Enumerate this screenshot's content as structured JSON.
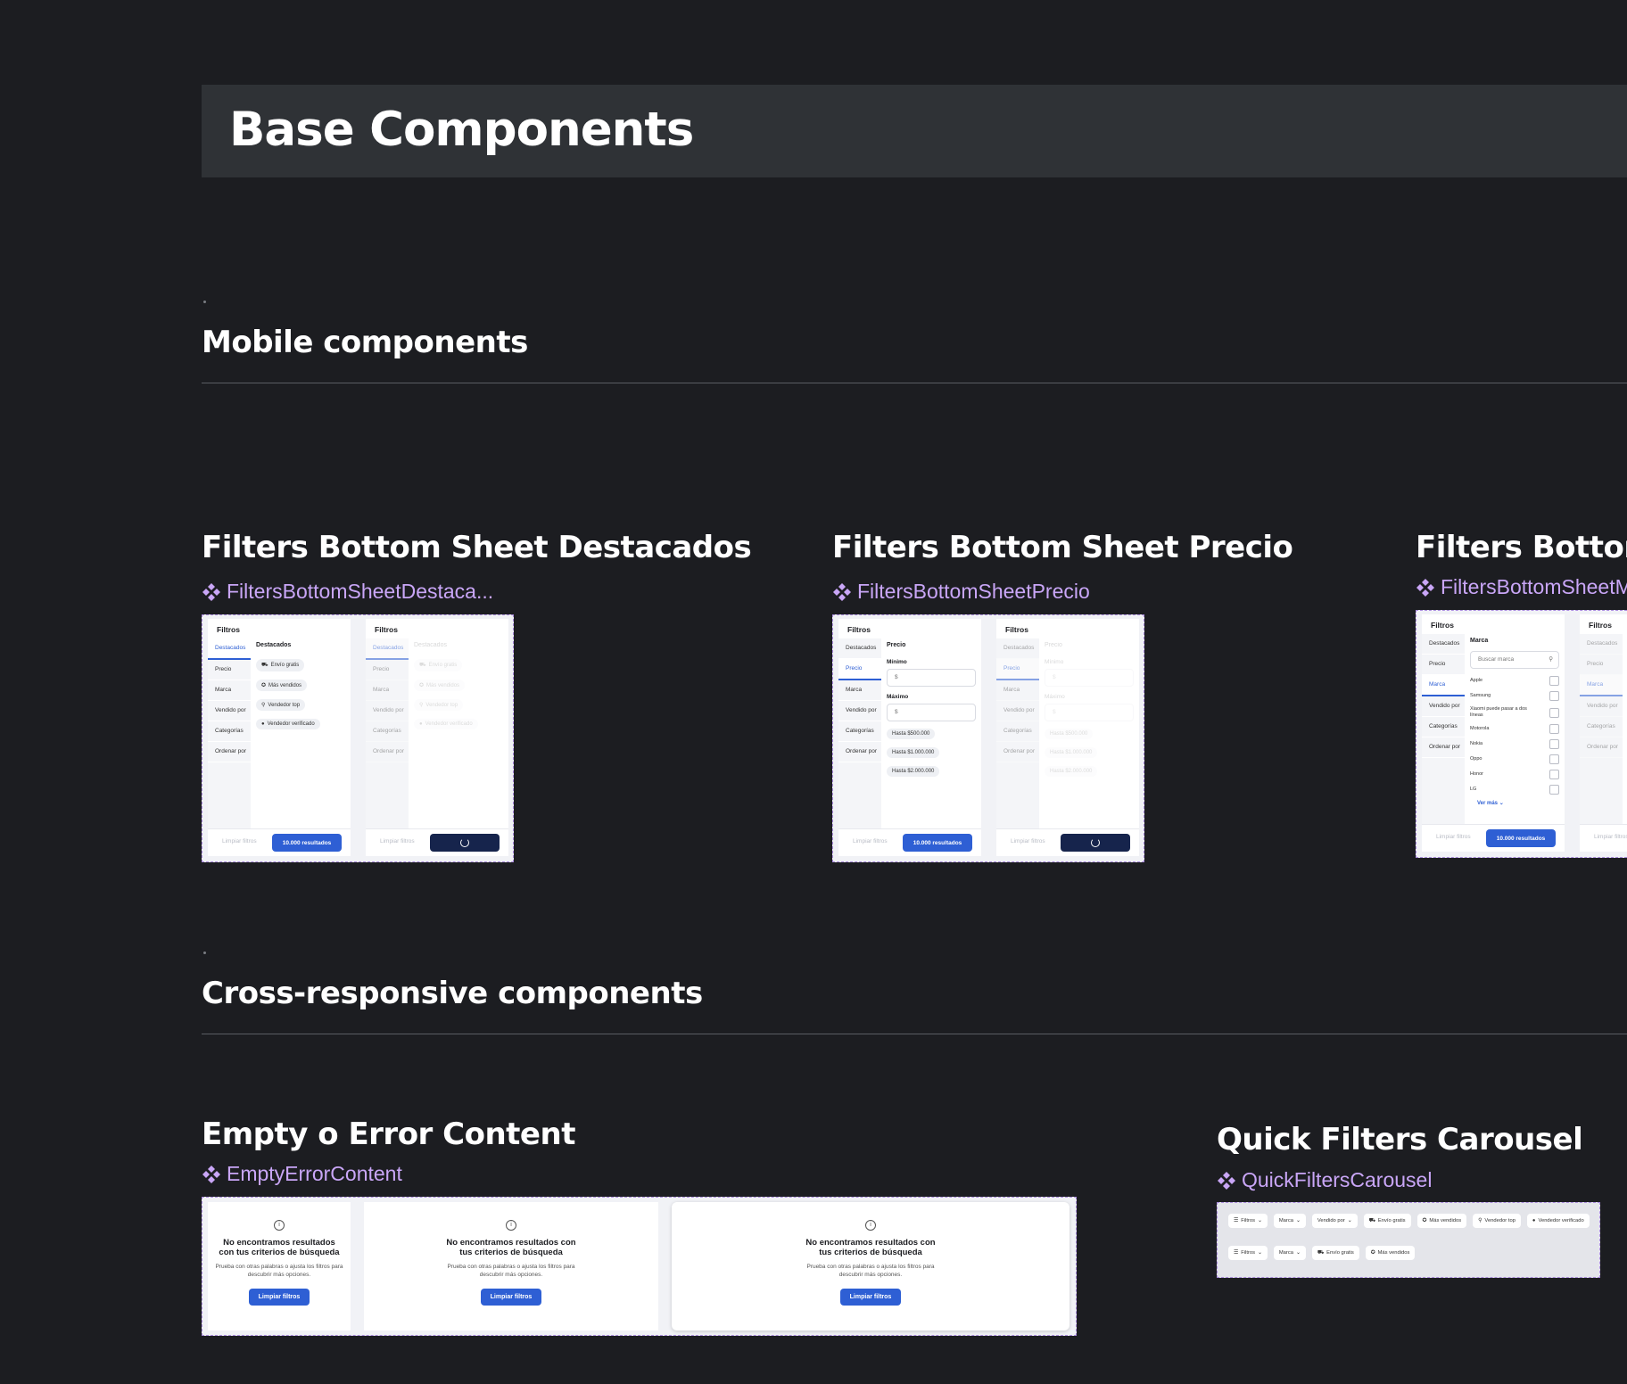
{
  "banner": {
    "title": "Base Components"
  },
  "sections": {
    "mobile": "Mobile components",
    "cross": "Cross-responsive components"
  },
  "components": {
    "destacados": {
      "title": "Filters Bottom Sheet Destacados",
      "link": "FiltersBottomSheetDestaca..."
    },
    "precio": {
      "title": "Filters Bottom Sheet Precio",
      "link": "FiltersBottomSheetPrecio"
    },
    "marca": {
      "title": "Filters Bottom S",
      "link": "FiltersBottomSheetM"
    },
    "empty": {
      "title": "Empty o Error Content",
      "link": "EmptyErrorContent"
    },
    "quick": {
      "title": "Quick Filters Carousel",
      "link": "QuickFiltersCarousel"
    }
  },
  "sheet": {
    "header": "Filtros",
    "sidebar": [
      "Destacados",
      "Precio",
      "Marca",
      "Vendido por",
      "Categorías",
      "Ordenar por"
    ],
    "clear": "Limpiar filtros",
    "results": "10.000 resultados"
  },
  "destacados_content": {
    "title": "Destacados",
    "chips": [
      {
        "icon": "truck-icon",
        "glyph": "⛟",
        "label": "Envío gratis"
      },
      {
        "icon": "star-icon",
        "glyph": "✪",
        "label": "Más vendidos"
      },
      {
        "icon": "medal-icon",
        "glyph": "⚲",
        "label": "Vendedor top"
      },
      {
        "icon": "verified-icon",
        "glyph": "●",
        "label": "Vendedor verificado"
      }
    ]
  },
  "precio_content": {
    "title": "Precio",
    "min_label": "Mínimo",
    "max_label": "Máximo",
    "currency": "$",
    "chips": [
      "Hasta $500.000",
      "Hasta $1.000.000",
      "Hasta $2.000.000"
    ]
  },
  "marca_content": {
    "title": "Marca",
    "search_placeholder": "Buscar marca",
    "brands": [
      "Apple",
      "Samsung",
      "Xiaomi puede pasar a dos líneas",
      "Motorola",
      "Nokia",
      "Oppo",
      "Honor",
      "LG"
    ],
    "see_more": "Ver más"
  },
  "empty_content": {
    "title": "No encontramos resultados con tus criterios de búsqueda",
    "subtitle": "Prueba con otras palabras o ajusta los filtros para descubrir más opciones.",
    "button": "Limpiar filtros"
  },
  "quick_filters": {
    "row1": [
      {
        "icon": "sliders-icon",
        "glyph": "☰",
        "label": "Filtros",
        "chevron": true
      },
      {
        "icon": "",
        "glyph": "",
        "label": "Marca",
        "chevron": true
      },
      {
        "icon": "",
        "glyph": "",
        "label": "Vendido por",
        "chevron": true
      },
      {
        "icon": "truck-icon",
        "glyph": "⛟",
        "label": "Envío gratis",
        "chevron": false
      },
      {
        "icon": "star-icon",
        "glyph": "✪",
        "label": "Más vendidos",
        "chevron": false
      },
      {
        "icon": "medal-icon",
        "glyph": "⚲",
        "label": "Vendedor top",
        "chevron": false
      },
      {
        "icon": "verified-icon",
        "glyph": "●",
        "label": "Vendedor verificado",
        "chevron": false
      }
    ],
    "row2": [
      {
        "icon": "sliders-icon",
        "glyph": "☰",
        "label": "Filtros",
        "chevron": true
      },
      {
        "icon": "",
        "glyph": "",
        "label": "Marca",
        "chevron": true
      },
      {
        "icon": "truck-icon",
        "glyph": "⛟",
        "label": "Envío gratis",
        "chevron": false
      },
      {
        "icon": "star-icon",
        "glyph": "✪",
        "label": "Más vendidos",
        "chevron": false
      }
    ]
  }
}
